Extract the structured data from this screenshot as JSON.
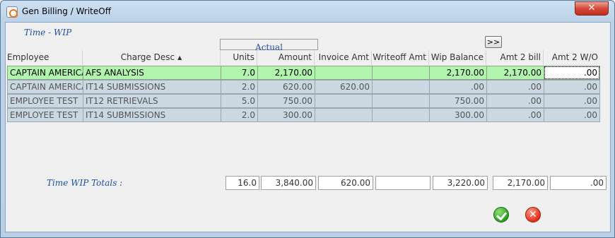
{
  "window": {
    "title": "Gen Billing / WriteOff",
    "close_label": "✕"
  },
  "section": {
    "title": "Time - WIP",
    "group_header": "Actual",
    "nav_button": ">>"
  },
  "columns": [
    "Employee",
    "Charge Desc",
    "Units",
    "Amount",
    "Invoice Amt",
    "Writeoff Amt",
    "Wip Balance",
    "Amt 2 bill",
    "Amt 2 W/O"
  ],
  "sort_indicator": "▲",
  "rows": [
    [
      "CAPTAIN AMERICA",
      "AFS ANALYSIS",
      "7.0",
      "2,170.00",
      "",
      "",
      "2,170.00",
      "2,170.00",
      ".00"
    ],
    [
      "CAPTAIN AMERICA",
      "IT14 SUBMISSIONS",
      "2.0",
      "620.00",
      "620.00",
      "",
      ".00",
      ".00",
      ".00"
    ],
    [
      "EMPLOYEE TEST",
      "IT12 RETRIEVALS",
      "5.0",
      "750.00",
      "",
      "",
      "750.00",
      ".00",
      ".00"
    ],
    [
      "EMPLOYEE TEST",
      "IT14 SUBMISSIONS",
      "2.0",
      "300.00",
      "",
      "",
      "300.00",
      ".00",
      ".00"
    ]
  ],
  "totals": {
    "label": "Time WIP Totals :",
    "values": [
      "16.0",
      "3,840.00",
      "620.00",
      "",
      "3,220.00",
      "2,170.00",
      ".00"
    ]
  },
  "actions": {
    "ok_icon": "check-icon",
    "cancel_icon": "x-icon",
    "cancel_glyph": "✕"
  },
  "colors": {
    "selected_row": "#b1f5ae",
    "row": "#cbd8e2",
    "section_title": "#1f4fa8"
  }
}
